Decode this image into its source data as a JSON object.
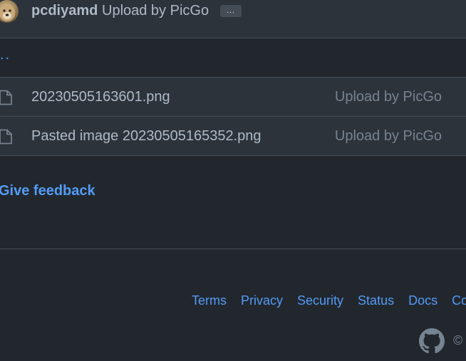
{
  "commit": {
    "author": "pcdiyamd",
    "message": "Upload by PicGo",
    "expand_label": "…"
  },
  "up_link": "..",
  "files": [
    {
      "name": "20230505163601.png",
      "commit_message": "Upload by PicGo",
      "icon": "file-icon"
    },
    {
      "name": "Pasted image 20230505165352.png",
      "commit_message": "Upload by PicGo",
      "icon": "file-icon"
    }
  ],
  "feedback_label": "Give feedback",
  "footer": {
    "links": [
      "Terms",
      "Privacy",
      "Security",
      "Status",
      "Docs",
      "Co"
    ],
    "copyright": "©",
    "logo": "github-mark-icon"
  },
  "colors": {
    "background": "#22272e",
    "row_background": "#2d333b",
    "link": "#539bf5",
    "text": "#adbac7",
    "muted": "#768390",
    "border": "#444c56"
  }
}
